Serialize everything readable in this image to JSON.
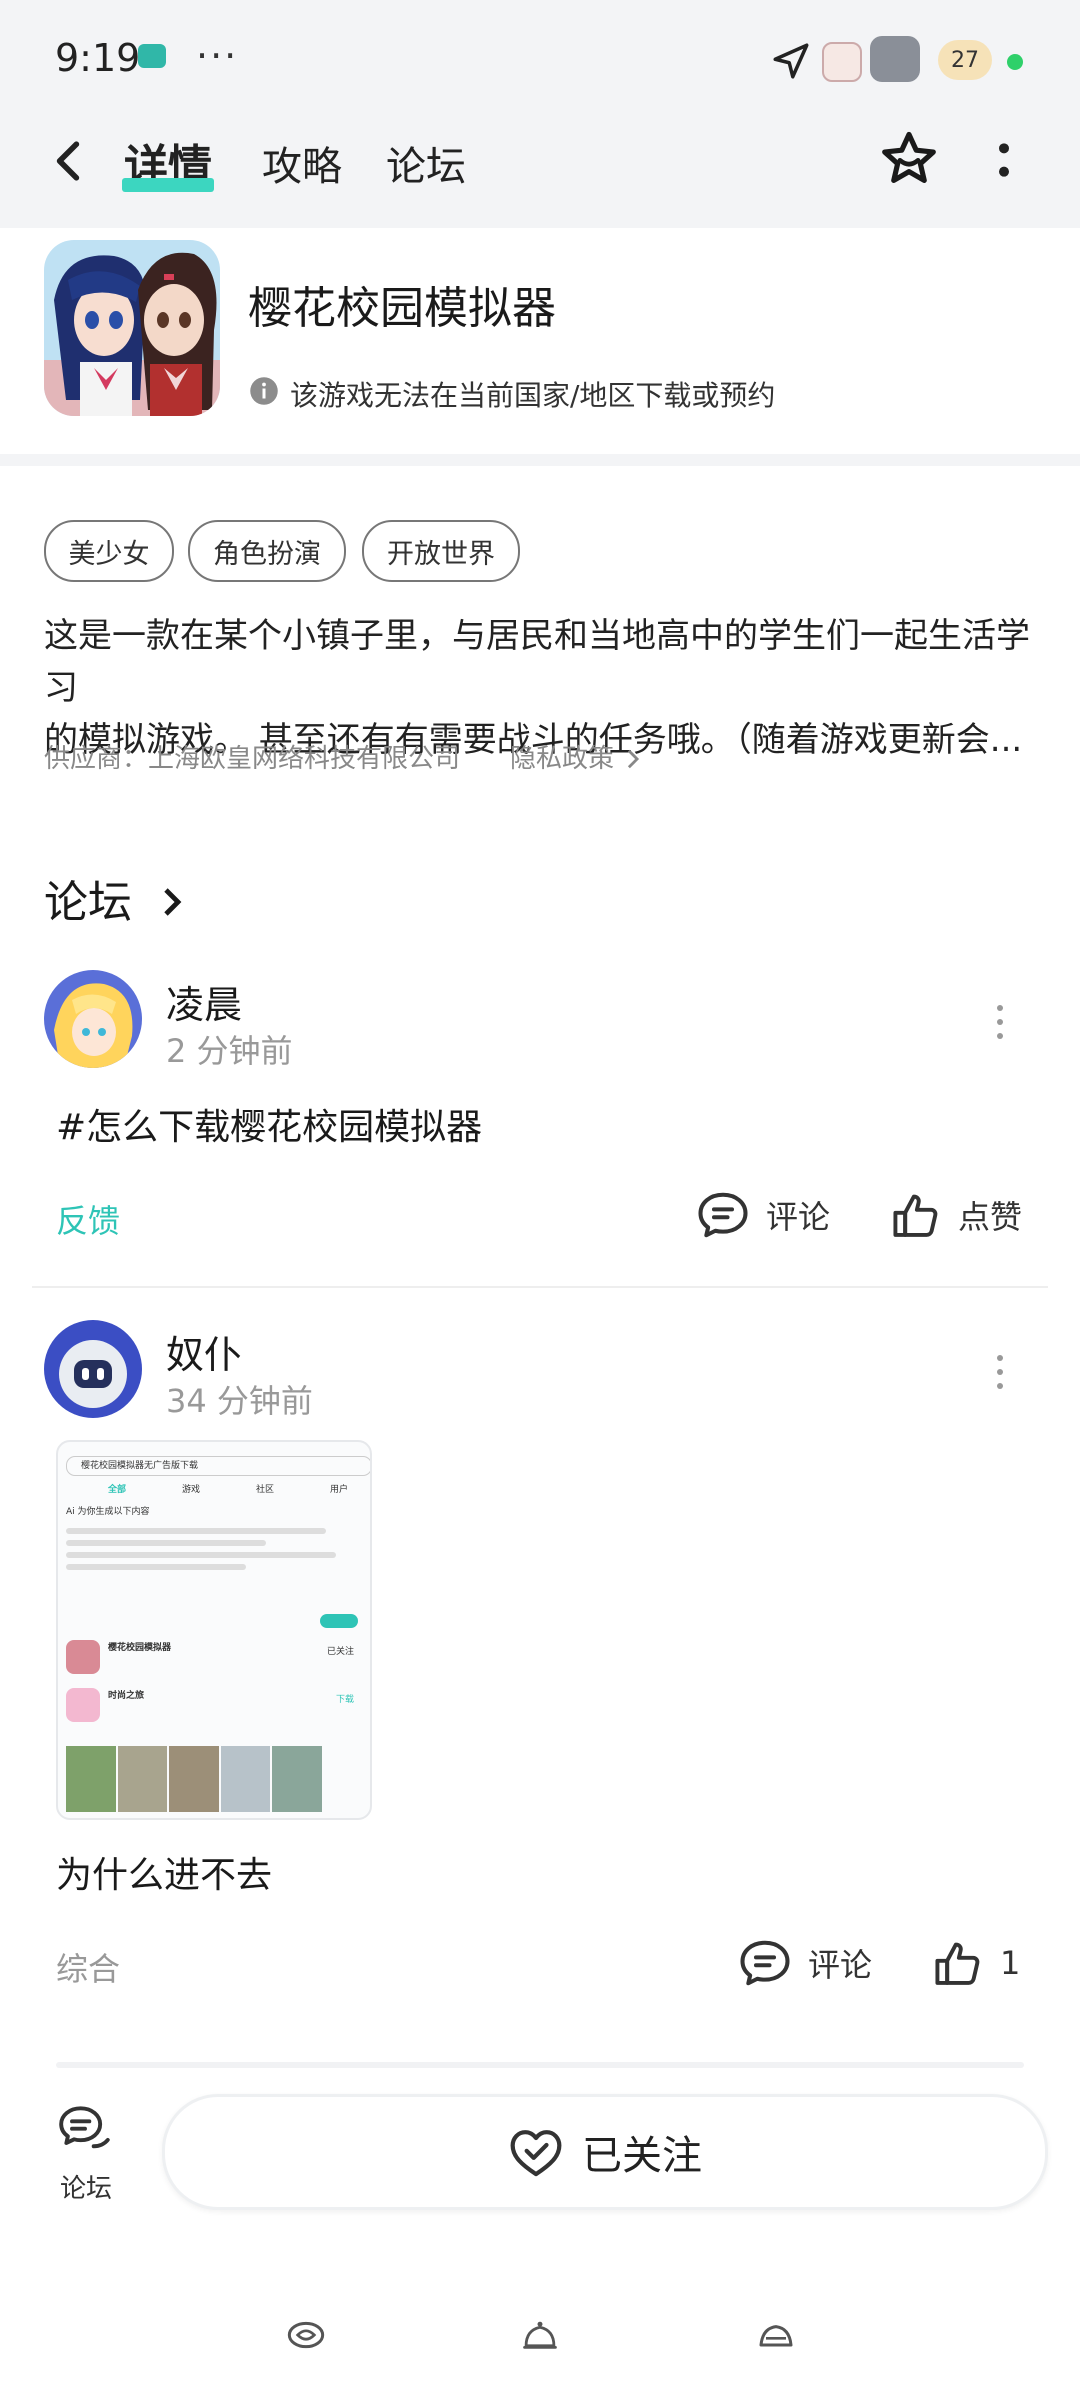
{
  "status_bar": {
    "time": "9:19",
    "dots": "···",
    "badge": "27"
  },
  "header": {
    "tabs": [
      {
        "label": "详情",
        "active": true
      },
      {
        "label": "攻略",
        "active": false
      },
      {
        "label": "论坛",
        "active": false
      }
    ],
    "accent_color": "#3cd6c0"
  },
  "app": {
    "title": "樱花校园模拟器",
    "notice": "该游戏无法在当前国家/地区下载或预约",
    "notice_icon": "info-icon",
    "tags": [
      "美少女",
      "角色扮演",
      "开放世界"
    ],
    "description_line1": "这是一款在某个小镇子里，与居民和当地高中的学生们一起生活学习",
    "description_line2": "的模拟游戏。 甚至还有有需要战斗的任务哦。（随着游戏更新会...",
    "provider": "供应商：上海欧皇网络科技有限公司",
    "privacy": "隐私政策"
  },
  "forum": {
    "title": "论坛",
    "posts": [
      {
        "username": "凌晨",
        "time": "2 分钟前",
        "text": "#怎么下载樱花校园模拟器",
        "category": "反馈",
        "category_color": "#2ec4b6",
        "comment_label": "评论",
        "like_label": "点赞"
      },
      {
        "username": "奴仆",
        "time": "34 分钟前",
        "text": "为什么进不去",
        "category": "综合",
        "category_color": "#999999",
        "comment_label": "评论",
        "like_label": "1"
      }
    ],
    "screenshot": {
      "search": "樱花校园模拟器无广告版下载",
      "tabs": [
        "全部",
        "游戏",
        "社区",
        "用户"
      ],
      "ai_line": "Ai 为你生成以下内容",
      "app1": "樱花校园模拟器",
      "app1_action": "已关注",
      "app2": "时尚之旅",
      "app2_action": "下载"
    }
  },
  "bottom": {
    "forum_label": "论坛",
    "follow_label": "已关注"
  }
}
